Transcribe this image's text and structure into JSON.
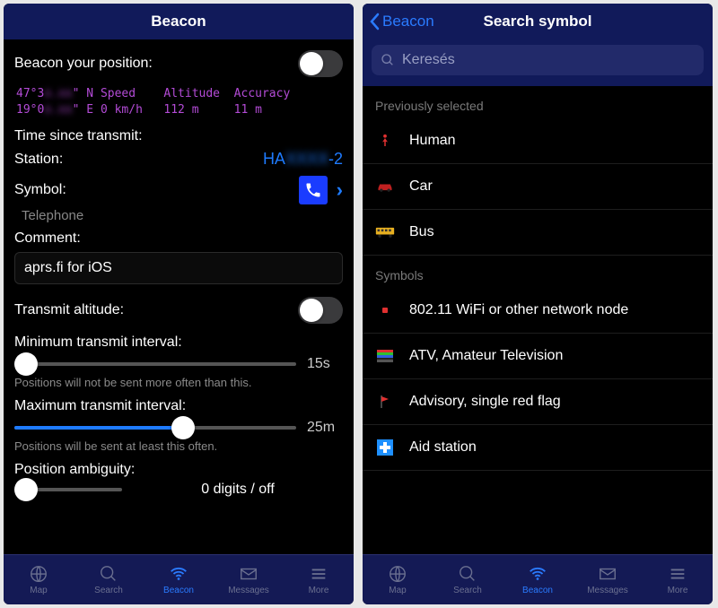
{
  "left": {
    "title": "Beacon",
    "beacon_position_label": "Beacon your position:",
    "gps_mono": "47°3▮.▮▮\" N Speed    Altitude  Accuracy\n19°0▮.▮▮\" E 0 km/h   112 m     11 m",
    "time_label": "Time since transmit:",
    "station_label": "Station:",
    "station_value_prefix": "HA",
    "station_value_suffix": "-2",
    "symbol_label": "Symbol:",
    "symbol_name": "Telephone",
    "comment_label": "Comment:",
    "comment_value": "aprs.fi for iOS",
    "transmit_alt_label": "Transmit altitude:",
    "min_interval_label": "Minimum transmit interval:",
    "min_interval_value": "15s",
    "min_interval_hint": "Positions will not be sent more often than this.",
    "max_interval_label": "Maximum transmit interval:",
    "max_interval_value": "25m",
    "max_interval_hint": "Positions will be sent at least this often.",
    "ambig_label": "Position ambiguity:",
    "ambig_value": "0 digits / off"
  },
  "right": {
    "back_label": "Beacon",
    "title": "Search symbol",
    "search_placeholder": "Keresés",
    "section1": "Previously selected",
    "section2": "Symbols",
    "prev": [
      {
        "label": "Human"
      },
      {
        "label": "Car"
      },
      {
        "label": "Bus"
      }
    ],
    "syms": [
      {
        "label": "802.11 WiFi or other network node"
      },
      {
        "label": "ATV, Amateur Television"
      },
      {
        "label": "Advisory, single red flag"
      },
      {
        "label": "Aid station"
      }
    ]
  },
  "tabs": {
    "map": "Map",
    "search": "Search",
    "beacon": "Beacon",
    "messages": "Messages",
    "more": "More"
  }
}
